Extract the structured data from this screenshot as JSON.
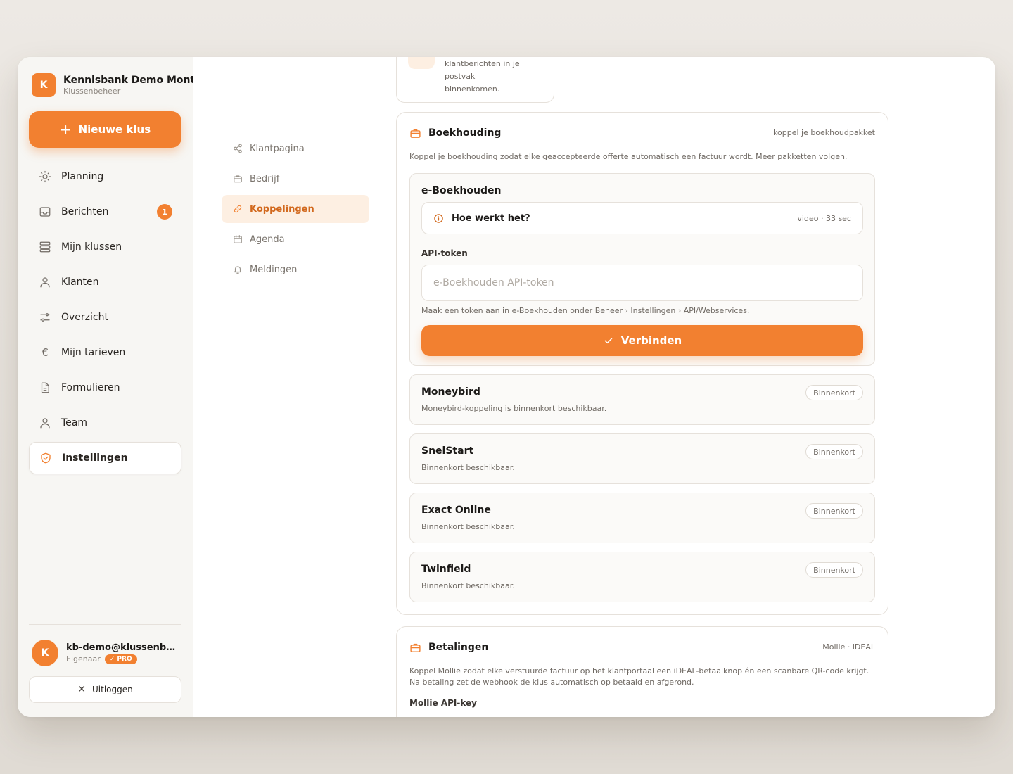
{
  "brand": {
    "initial": "K",
    "name": "Kennisbank Demo Montage",
    "subtitle": "Klussenbeheer"
  },
  "new_button": {
    "label": "Nieuwe klus"
  },
  "nav": [
    {
      "label": "Planning",
      "icon": "sun-icon"
    },
    {
      "label": "Berichten",
      "icon": "inbox-icon",
      "badge": "1"
    },
    {
      "label": "Mijn klussen",
      "icon": "stack-icon"
    },
    {
      "label": "Klanten",
      "icon": "user-icon"
    },
    {
      "label": "Overzicht",
      "icon": "sliders-icon"
    },
    {
      "label": "Mijn tarieven",
      "icon": "euro-icon"
    },
    {
      "label": "Formulieren",
      "icon": "document-icon"
    },
    {
      "label": "Team",
      "icon": "user-icon"
    },
    {
      "label": "Instellingen",
      "icon": "shield-icon",
      "active": true
    }
  ],
  "user": {
    "initial": "K",
    "email": "kb-demo@klussenbeheer.nl",
    "role": "Eigenaar",
    "plan": "PRO"
  },
  "logout": {
    "label": "Uitloggen"
  },
  "subnav": [
    {
      "label": "Klantpagina",
      "icon": "share-icon"
    },
    {
      "label": "Bedrijf",
      "icon": "briefcase-icon"
    },
    {
      "label": "Koppelingen",
      "icon": "link-icon",
      "active": true
    },
    {
      "label": "Agenda",
      "icon": "calendar-icon"
    },
    {
      "label": "Meldingen",
      "icon": "bell-icon"
    }
  ],
  "top_card": {
    "text": "klantberichten in je postvak binnenkomen."
  },
  "boekhouding": {
    "title": "Boekhouding",
    "right": "koppel je boekhoudpakket",
    "description": "Koppel je boekhouding zodat elke geaccepteerde offerte automatisch een factuur wordt. Meer pakketten volgen.",
    "eboekhouden": {
      "title": "e-Boekhouden",
      "howto_label": "Hoe werkt het?",
      "howto_meta": "video · 33 sec",
      "field_label": "API-token",
      "placeholder": "e-Boekhouden API-token",
      "hint": "Maak een token aan in e-Boekhouden onder Beheer › Instellingen › API/Webservices.",
      "connect_label": "Verbinden"
    },
    "providers": [
      {
        "title": "Moneybird",
        "description": "Moneybird-koppeling is binnenkort beschikbaar.",
        "status": "Binnenkort"
      },
      {
        "title": "SnelStart",
        "description": "Binnenkort beschikbaar.",
        "status": "Binnenkort"
      },
      {
        "title": "Exact Online",
        "description": "Binnenkort beschikbaar.",
        "status": "Binnenkort"
      },
      {
        "title": "Twinfield",
        "description": "Binnenkort beschikbaar.",
        "status": "Binnenkort"
      }
    ]
  },
  "betalingen": {
    "title": "Betalingen",
    "right": "Mollie · iDEAL",
    "description": "Koppel Mollie zodat elke verstuurde factuur op het klantportaal een iDEAL-betaalknop én een scanbare QR-code krijgt. Na betaling zet de webhook de klus automatisch op betaald en afgerond.",
    "field_label": "Mollie API-key"
  },
  "colors": {
    "accent": "#f28030",
    "accent_soft": "#fdefe2",
    "sidebar_bg": "#f7f6f3"
  }
}
